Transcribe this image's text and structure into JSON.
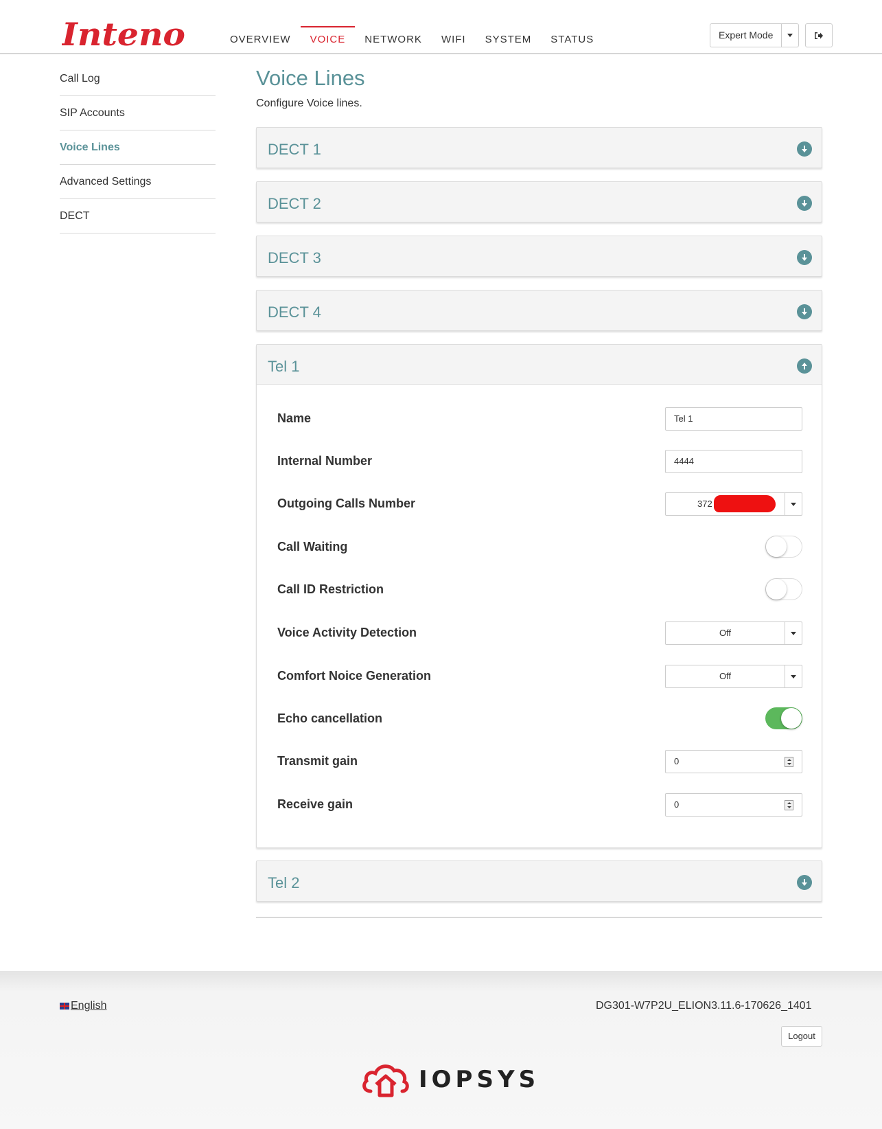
{
  "brand": {
    "logo_text": "Inteno",
    "color": "#d9242f",
    "accent": "#5a9298"
  },
  "nav": {
    "items": [
      "OVERVIEW",
      "VOICE",
      "NETWORK",
      "WIFI",
      "SYSTEM",
      "STATUS"
    ],
    "active": "VOICE"
  },
  "mode": {
    "label": "Expert Mode"
  },
  "sidebar": {
    "items": [
      {
        "label": "Call Log"
      },
      {
        "label": "SIP Accounts"
      },
      {
        "label": "Voice Lines"
      },
      {
        "label": "Advanced Settings"
      },
      {
        "label": "DECT"
      }
    ],
    "active": "Voice Lines"
  },
  "page": {
    "title": "Voice Lines",
    "subtitle": "Configure Voice lines."
  },
  "panels": [
    {
      "title": "DECT 1",
      "open": false
    },
    {
      "title": "DECT 2",
      "open": false
    },
    {
      "title": "DECT 3",
      "open": false
    },
    {
      "title": "DECT 4",
      "open": false
    },
    {
      "title": "Tel 1",
      "open": true
    },
    {
      "title": "Tel 2",
      "open": false
    }
  ],
  "tel1": {
    "name": {
      "label": "Name",
      "value": "Tel 1"
    },
    "internal_number": {
      "label": "Internal Number",
      "value": "4444"
    },
    "outgoing": {
      "label": "Outgoing Calls Number",
      "value": "372"
    },
    "call_waiting": {
      "label": "Call Waiting",
      "on": false
    },
    "call_id_restriction": {
      "label": "Call ID Restriction",
      "on": false
    },
    "vad": {
      "label": "Voice Activity Detection",
      "value": "Off"
    },
    "cng": {
      "label": "Comfort Noice Generation",
      "value": "Off"
    },
    "echo": {
      "label": "Echo cancellation",
      "on": true
    },
    "tx_gain": {
      "label": "Transmit gain",
      "value": "0"
    },
    "rx_gain": {
      "label": "Receive gain",
      "value": "0"
    }
  },
  "footer": {
    "language": "English",
    "version": "DG301-W7P2U_ELION3.11.6-170626_1401",
    "logout": "Logout",
    "partner": "IOPSYS"
  }
}
